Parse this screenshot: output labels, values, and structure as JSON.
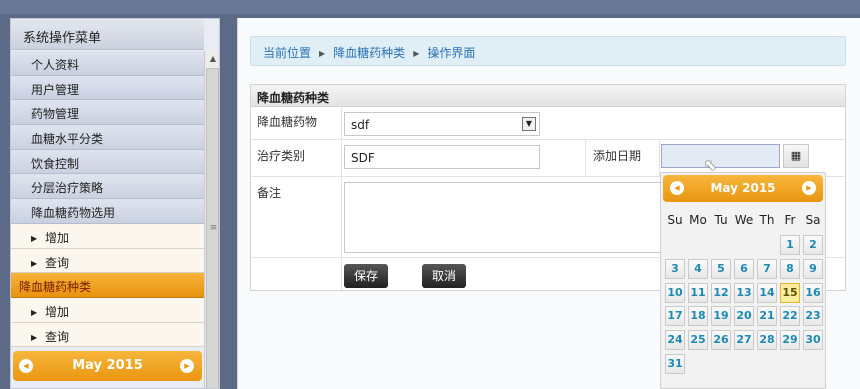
{
  "sidebar": {
    "title": "系统操作菜单",
    "items": [
      {
        "label": "个人资料",
        "kind": "main"
      },
      {
        "label": "用户管理",
        "kind": "main"
      },
      {
        "label": "药物管理",
        "kind": "main"
      },
      {
        "label": "血糖水平分类",
        "kind": "main"
      },
      {
        "label": "饮食控制",
        "kind": "main"
      },
      {
        "label": "分层治疗策略",
        "kind": "main"
      },
      {
        "label": "降血糖药物选用",
        "kind": "main"
      },
      {
        "label": "增加",
        "kind": "sub"
      },
      {
        "label": "查询",
        "kind": "sub"
      },
      {
        "label": "降血糖药种类",
        "kind": "active"
      },
      {
        "label": "增加",
        "kind": "sub"
      },
      {
        "label": "查询",
        "kind": "sub"
      }
    ],
    "calendar_month": "May 2015"
  },
  "breadcrumb": {
    "items": [
      "当前位置",
      "降血糖药种类",
      "操作界面"
    ]
  },
  "form": {
    "panel_title": "降血糖药种类",
    "drug_label": "降血糖药物",
    "drug_value": "sdf",
    "category_label": "治疗类别",
    "category_value": "SDF",
    "date_label": "添加日期",
    "date_value": "",
    "note_label": "备注",
    "save_label": "保存",
    "cancel_label": "取消"
  },
  "datepicker": {
    "month": "May 2015",
    "weekdays": [
      "Su",
      "Mo",
      "Tu",
      "We",
      "Th",
      "Fr",
      "Sa"
    ],
    "first_weekday_index": 5,
    "days_in_month": 31,
    "today": 15
  },
  "colors": {
    "accent_orange": "#e99610",
    "day_text": "#1d8ab2",
    "breadcrumb_link": "#2b72b4"
  }
}
